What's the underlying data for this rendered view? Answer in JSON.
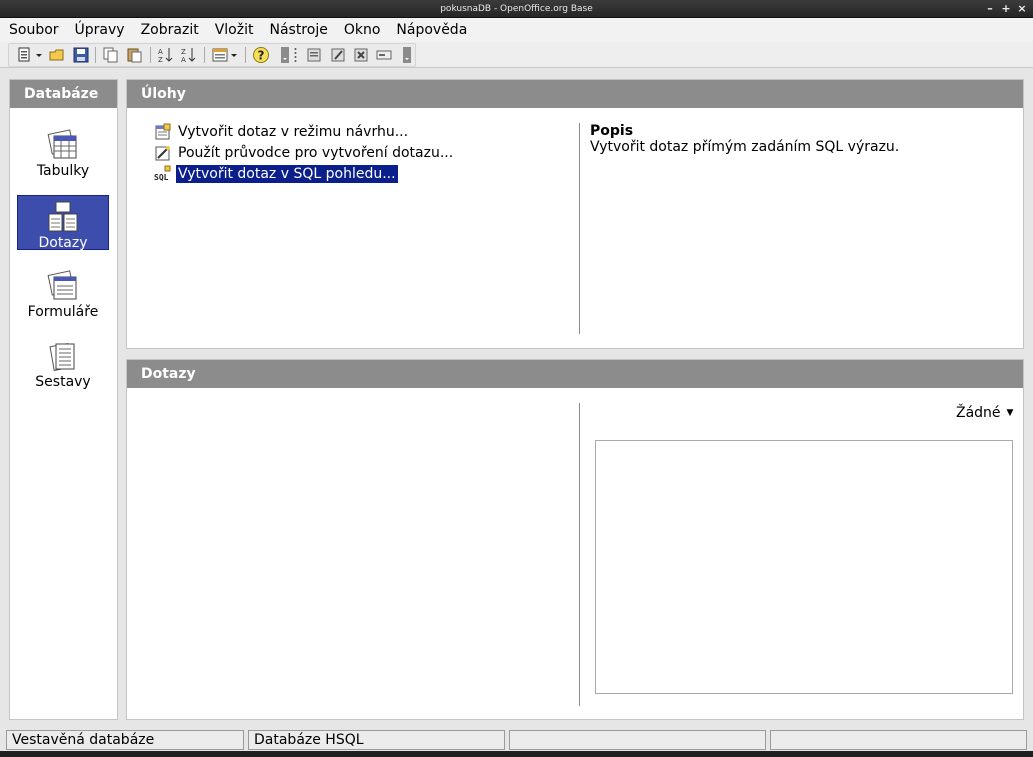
{
  "window": {
    "title": "pokusnaDB - OpenOffice.org Base"
  },
  "menu": [
    "Soubor",
    "Úpravy",
    "Zobrazit",
    "Vložit",
    "Nástroje",
    "Okno",
    "Nápověda"
  ],
  "left_panel": {
    "title": "Databáze",
    "items": [
      {
        "label": "Tabulky",
        "icon": "tables-icon",
        "selected": false
      },
      {
        "label": "Dotazy",
        "icon": "queries-icon",
        "selected": true
      },
      {
        "label": "Formuláře",
        "icon": "forms-icon",
        "selected": false
      },
      {
        "label": "Sestavy",
        "icon": "reports-icon",
        "selected": false
      }
    ]
  },
  "tasks_panel": {
    "title": "Úlohy",
    "items": [
      {
        "label": "Vytvořit dotaz v režimu návrhu...",
        "icon": "design-view-icon",
        "selected": false
      },
      {
        "label": "Použít průvodce pro vytvoření dotazu...",
        "icon": "wizard-icon",
        "selected": false
      },
      {
        "label": "Vytvořit dotaz v SQL pohledu...",
        "icon": "sql-icon",
        "selected": true
      }
    ],
    "description": {
      "title": "Popis",
      "text": "Vytvořit dotaz přímým zadáním SQL výrazu."
    }
  },
  "queries_panel": {
    "title": "Dotazy",
    "preview_option": "Žádné"
  },
  "statusbar": [
    "Vestavěná databáze",
    "Databáze HSQL",
    "",
    ""
  ],
  "colors": {
    "panel_header": "#8c8c8c",
    "selection": "#0a1e8c",
    "nav_selection": "#3d4dab"
  }
}
